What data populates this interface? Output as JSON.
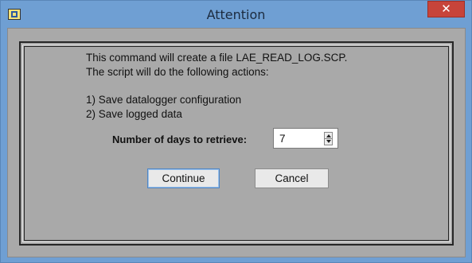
{
  "window": {
    "title": "Attention",
    "close_label": "✕"
  },
  "message": {
    "line1": "This command will create a file LAE_READ_LOG.SCP.",
    "line2": "The script will do the following actions:",
    "line3": "1) Save datalogger configuration",
    "line4": "2) Save logged data"
  },
  "days": {
    "label": "Number of days to retrieve:",
    "value": "7"
  },
  "buttons": {
    "continue": "Continue",
    "cancel": "Cancel"
  }
}
